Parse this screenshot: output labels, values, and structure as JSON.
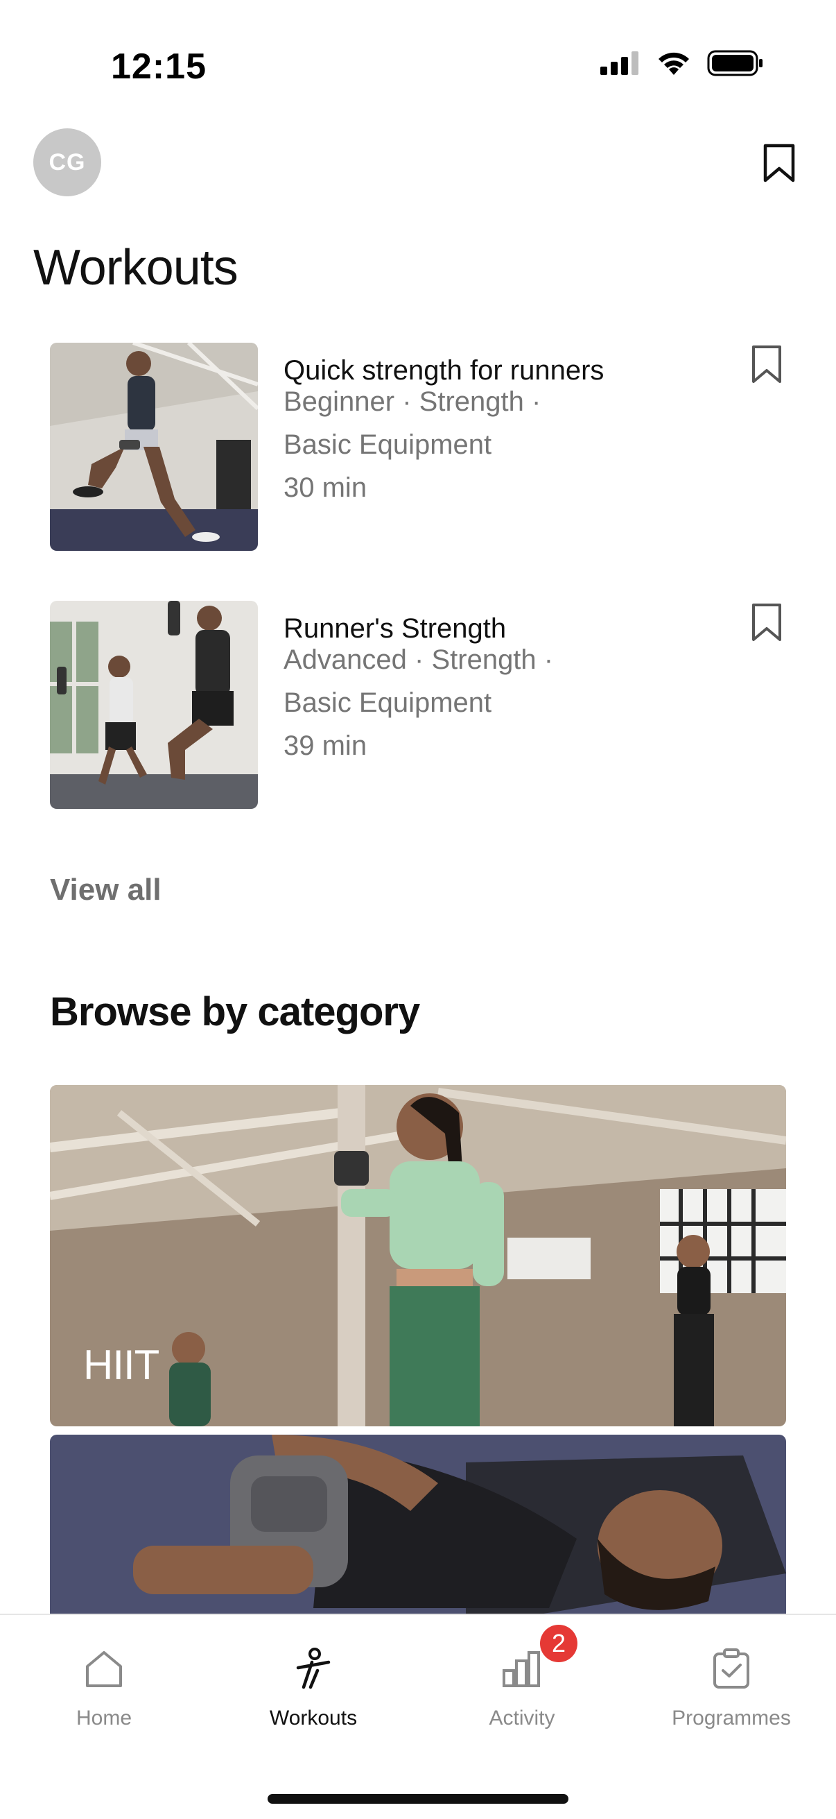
{
  "status_bar": {
    "time": "12:15"
  },
  "header": {
    "avatar_initials": "CG",
    "title": "Workouts"
  },
  "workouts": [
    {
      "title": "Quick strength for runners",
      "meta_line1": "Beginner · Strength ·",
      "meta_line2": "Basic Equipment",
      "duration": "30 min"
    },
    {
      "title": "Runner's Strength",
      "meta_line1": "Advanced · Strength ·",
      "meta_line2": "Basic Equipment",
      "duration": "39 min"
    }
  ],
  "view_all": "View all",
  "browse": {
    "title": "Browse by category",
    "categories": [
      {
        "label": "HIIT"
      },
      {
        "label": ""
      }
    ]
  },
  "tab_bar": {
    "tabs": [
      {
        "label": "Home",
        "icon": "home-icon"
      },
      {
        "label": "Workouts",
        "icon": "workouts-icon"
      },
      {
        "label": "Activity",
        "icon": "activity-icon",
        "badge": "2"
      },
      {
        "label": "Programmes",
        "icon": "programmes-icon"
      }
    ],
    "active_tab": "Workouts"
  },
  "colors": {
    "badge": "#e53935",
    "muted_text": "#757575",
    "avatar_bg": "#c8c8c8"
  }
}
